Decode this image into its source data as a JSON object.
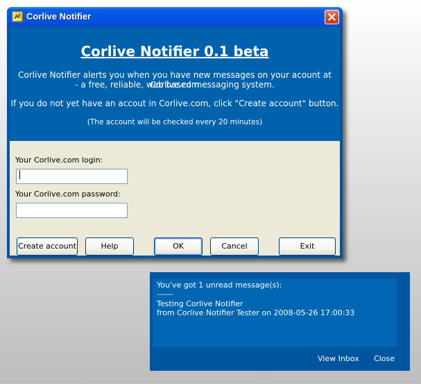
{
  "window": {
    "title": "Corlive Notifier",
    "icon": "notifier-app-icon",
    "close_icon": "close-icon"
  },
  "banner": {
    "heading": "Corlive Notifier 0.1 beta",
    "line1": "Corlive Notifier alerts you when you have new messages on your acount at Corlive.com",
    "line2": "- a free, reliable, web based messaging system.",
    "line3": "If you do not yet have an accout in Corlive.com, click \"Create account\" button.",
    "note": "(The account will be checked every 20 minutes)"
  },
  "form": {
    "login_label": "Your Corlive.com login:",
    "login_value": "",
    "password_label": "Your Corlive.com password:",
    "password_value": ""
  },
  "buttons": {
    "create_account": "Create account",
    "help": "Help",
    "ok": "OK",
    "cancel": "Cancel",
    "exit": "Exit"
  },
  "notification": {
    "line1": "You've got 1 unread message(s):",
    "separator": "------",
    "subject": "Testing Corlive Notifier",
    "from": "from Corlive Notifier Tester on 2008-05-26 17:00:33",
    "view_inbox": "View Inbox",
    "close": "Close"
  },
  "colors": {
    "banner_bg": "#0061ad",
    "client_bg": "#ece9d8",
    "popup_bg": "#0055a0",
    "titlebar": "#0554e3"
  }
}
